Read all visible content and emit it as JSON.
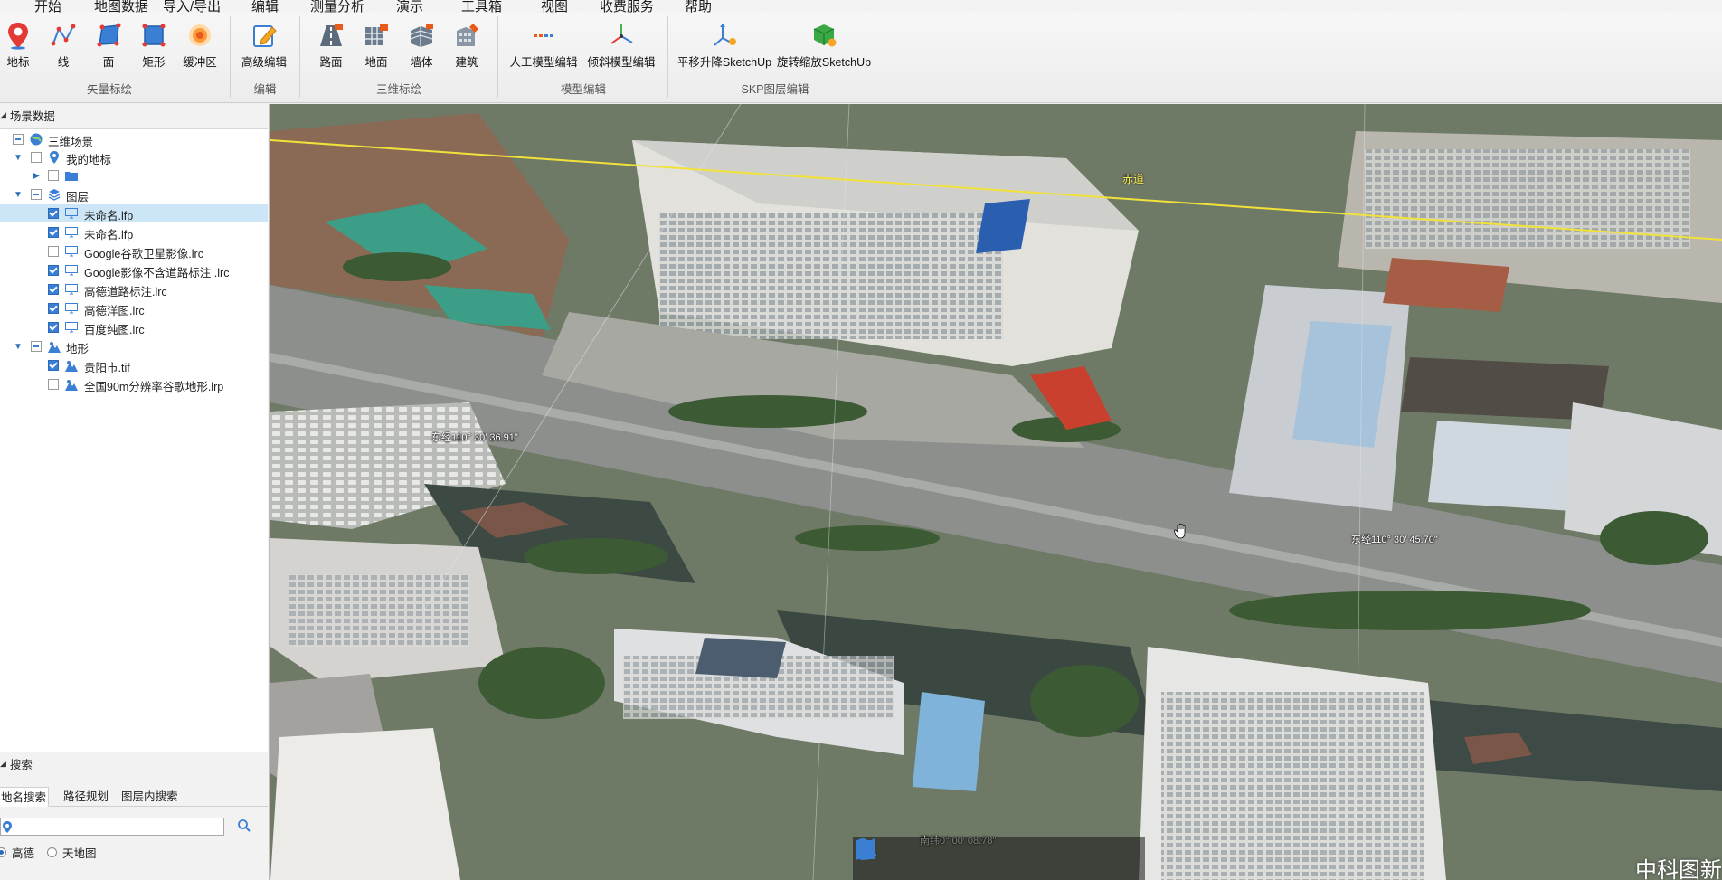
{
  "menu": [
    "开始",
    "地图数据",
    "导入/导出",
    "编辑",
    "测量分析",
    "演示",
    "工具箱",
    "视图",
    "收费服务",
    "帮助"
  ],
  "ribbon": {
    "groups": [
      {
        "label": "矢量标绘",
        "buttons": [
          {
            "label": "地标",
            "icon": "pin-icon"
          },
          {
            "label": "线",
            "icon": "polyline-icon"
          },
          {
            "label": "面",
            "icon": "polygon-icon"
          },
          {
            "label": "矩形",
            "icon": "rectangle-icon"
          },
          {
            "label": "缓冲区",
            "icon": "buffer-icon"
          }
        ]
      },
      {
        "label": "编辑",
        "buttons": [
          {
            "label": "高级编辑",
            "icon": "edit-icon"
          }
        ]
      },
      {
        "label": "三维标绘",
        "buttons": [
          {
            "label": "路面",
            "icon": "road-icon"
          },
          {
            "label": "地面",
            "icon": "ground-icon"
          },
          {
            "label": "墙体",
            "icon": "wall-icon"
          },
          {
            "label": "建筑",
            "icon": "building-icon"
          }
        ]
      },
      {
        "label": "模型编辑",
        "buttons": [
          {
            "label": "人工模型编辑",
            "icon": "manual-model-icon"
          },
          {
            "label": "倾斜模型编辑",
            "icon": "oblique-model-icon"
          }
        ]
      },
      {
        "label": "SKP图层编辑",
        "buttons": [
          {
            "label": "平移升降SketchUp",
            "icon": "move-axis-icon"
          },
          {
            "label": "旋转缩放SketchUp",
            "icon": "rotate-scale-icon"
          }
        ]
      }
    ]
  },
  "scene_panel": {
    "title": "场景数据",
    "tree": [
      {
        "label": "三维场景",
        "level": 0,
        "expanded": true,
        "check": "minus",
        "icon": "globe-icon"
      },
      {
        "label": "我的地标",
        "level": 1,
        "expanded": true,
        "check": "none",
        "icon": "placemark-icon"
      },
      {
        "label": "",
        "level": 2,
        "expanded": false,
        "check": "none",
        "icon": "folder-icon"
      },
      {
        "label": "图层",
        "level": 1,
        "expanded": true,
        "check": "minus",
        "icon": "layers-icon"
      },
      {
        "label": "未命名.lfp",
        "level": 2,
        "check": "checked",
        "icon": "monitor-icon",
        "selected": true
      },
      {
        "label": "未命名.lfp",
        "level": 2,
        "check": "checked",
        "icon": "monitor-icon"
      },
      {
        "label": "Google谷歌卫星影像.lrc",
        "level": 2,
        "check": "none",
        "icon": "monitor-icon"
      },
      {
        "label": "Google影像不含道路标注 .lrc",
        "level": 2,
        "check": "checked",
        "icon": "monitor-icon"
      },
      {
        "label": "高德道路标注.lrc",
        "level": 2,
        "check": "checked",
        "icon": "monitor-icon"
      },
      {
        "label": "高德洋图.lrc",
        "level": 2,
        "check": "checked",
        "icon": "monitor-icon"
      },
      {
        "label": "百度纯图.lrc",
        "level": 2,
        "check": "checked",
        "icon": "monitor-icon"
      },
      {
        "label": "地形",
        "level": 1,
        "expanded": true,
        "check": "minus",
        "icon": "terrain-icon"
      },
      {
        "label": "贵阳市.tif",
        "level": 2,
        "check": "checked",
        "icon": "terrain-icon"
      },
      {
        "label": "全国90m分辨率谷歌地形.lrp",
        "level": 2,
        "check": "none",
        "icon": "terrain-icon"
      }
    ]
  },
  "search_panel": {
    "title": "搜索",
    "tabs": [
      "地名搜索",
      "路径规划",
      "图层内搜索"
    ],
    "active_tab": 0,
    "input_value": "",
    "radios": [
      {
        "label": "高德",
        "selected": true
      },
      {
        "label": "天地图",
        "selected": false
      }
    ]
  },
  "viewport": {
    "equator_label": "赤道",
    "coords": [
      {
        "id": "c1",
        "text": "东经110° 30′  36.91\""
      },
      {
        "id": "c2",
        "text": "东经110° 30′  45.70\""
      },
      {
        "id": "c3",
        "text": "南纬0° 00′  08.78\""
      }
    ],
    "watermark": "中科图新"
  },
  "bottom_toolbar": [
    "pan-hand-icon",
    "select-arrow-icon",
    "placemark-icon",
    "line-tool-icon",
    "area-tool-icon",
    "chart-tool-icon"
  ],
  "colors": {
    "accent": "#3b7fd4",
    "selected_row": "#cde6f7",
    "equator": "#f0e23a"
  }
}
